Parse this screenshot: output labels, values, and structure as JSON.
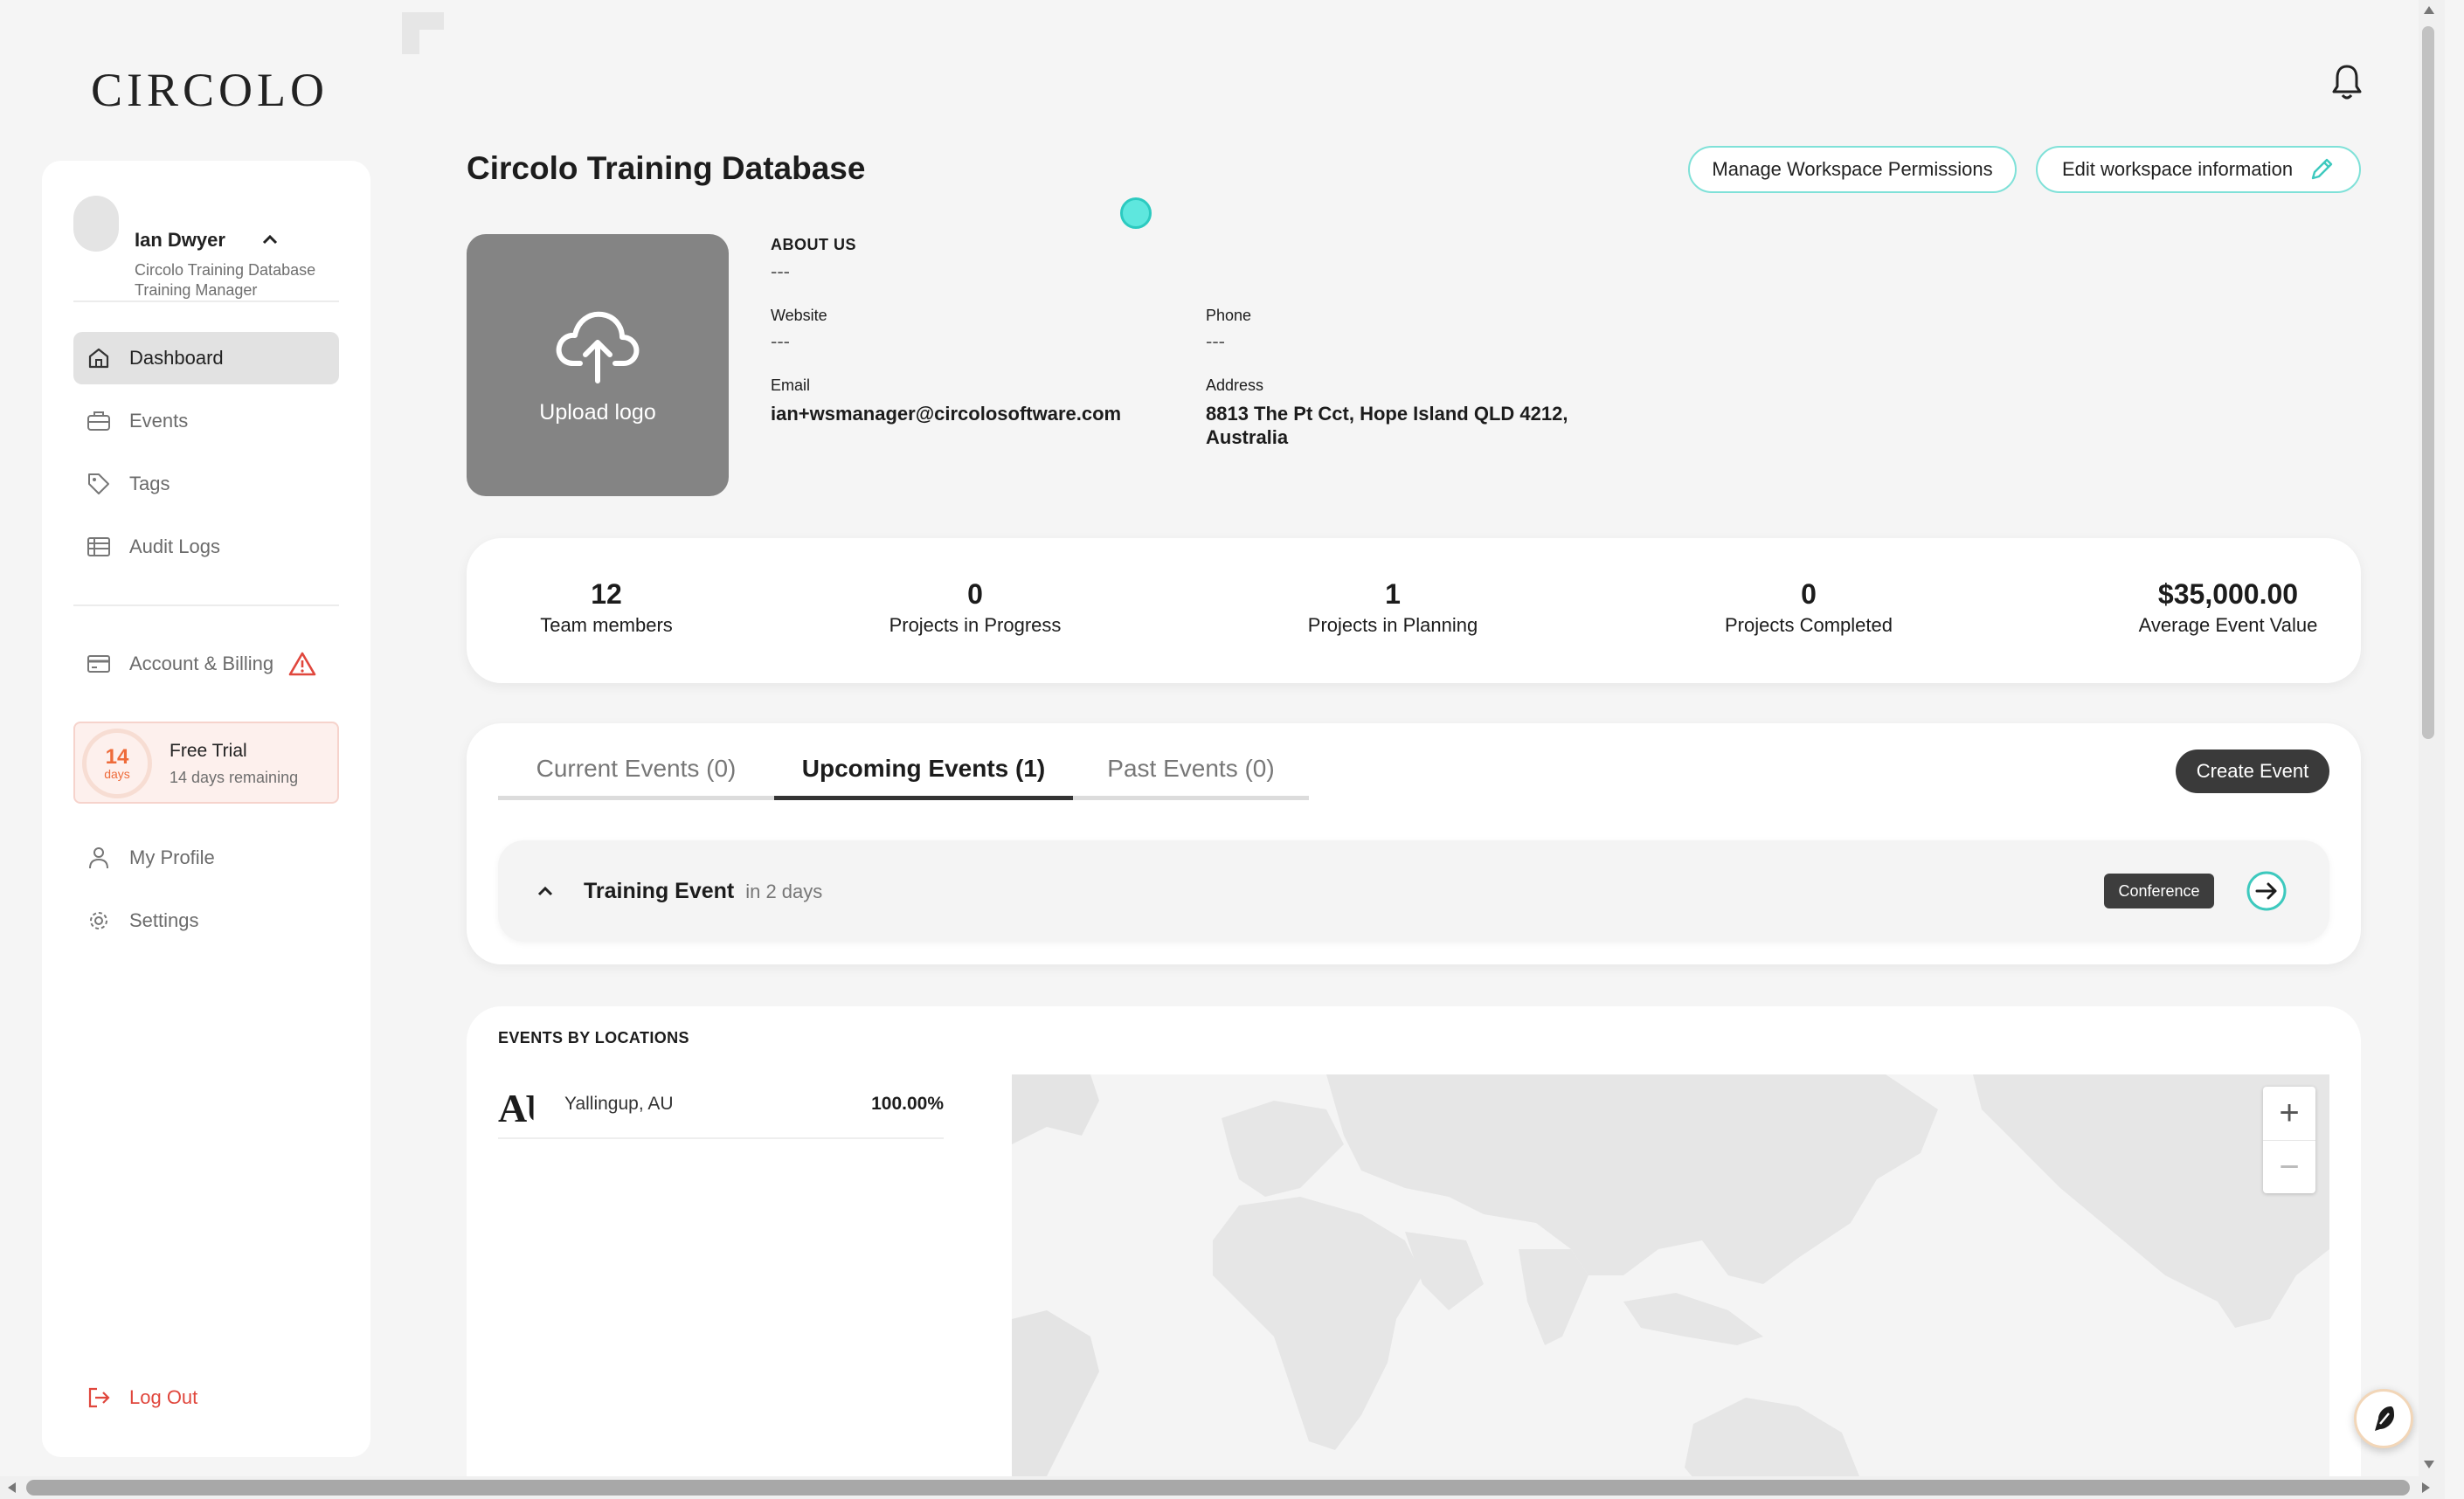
{
  "brand": "CIRCOLO",
  "user": {
    "name": "Ian Dwyer",
    "org": "Circolo Training Database",
    "role": "Training Manager"
  },
  "nav": {
    "dashboard": "Dashboard",
    "events": "Events",
    "tags": "Tags",
    "audit_logs": "Audit Logs",
    "account_billing": "Account & Billing",
    "my_profile": "My Profile",
    "settings": "Settings",
    "log_out": "Log Out"
  },
  "trial": {
    "days_number": "14",
    "days_unit": "days",
    "title": "Free Trial",
    "subtitle": "14 days remaining"
  },
  "header": {
    "title": "Circolo Training Database",
    "manage_permissions": "Manage Workspace Permissions",
    "edit_workspace": "Edit workspace information"
  },
  "workspace": {
    "upload_label": "Upload logo",
    "about_label": "ABOUT US",
    "about_value": "---",
    "website_label": "Website",
    "website_value": "---",
    "phone_label": "Phone",
    "phone_value": "---",
    "email_label": "Email",
    "email_value": "ian+wsmanager@circolosoftware.com",
    "address_label": "Address",
    "address_line1": "8813 The Pt Cct, Hope Island QLD 4212,",
    "address_line2": "Australia"
  },
  "stats": [
    {
      "value": "12",
      "label": "Team members"
    },
    {
      "value": "0",
      "label": "Projects in Progress"
    },
    {
      "value": "1",
      "label": "Projects in Planning"
    },
    {
      "value": "0",
      "label": "Projects Completed"
    },
    {
      "value": "$35,000.00",
      "label": "Average Event Value"
    }
  ],
  "events_panel": {
    "tabs": [
      {
        "label": "Current Events (0)",
        "active": false
      },
      {
        "label": "Upcoming Events (1)",
        "active": true
      },
      {
        "label": "Past Events (0)",
        "active": false
      }
    ],
    "create_button": "Create Event",
    "event": {
      "name": "Training Event",
      "when": "in 2 days",
      "type": "Conference"
    }
  },
  "locations": {
    "title": "EVENTS BY LOCATIONS",
    "items": [
      {
        "flag_text": "AU",
        "name": "Yallingup, AU",
        "percent": "100.00%"
      }
    ]
  },
  "map": {
    "zoom_in": "+",
    "zoom_out": "−"
  },
  "colors": {
    "accent": "#7fe1d8",
    "alert": "#e0473d",
    "trial": "#ee6b3a"
  }
}
